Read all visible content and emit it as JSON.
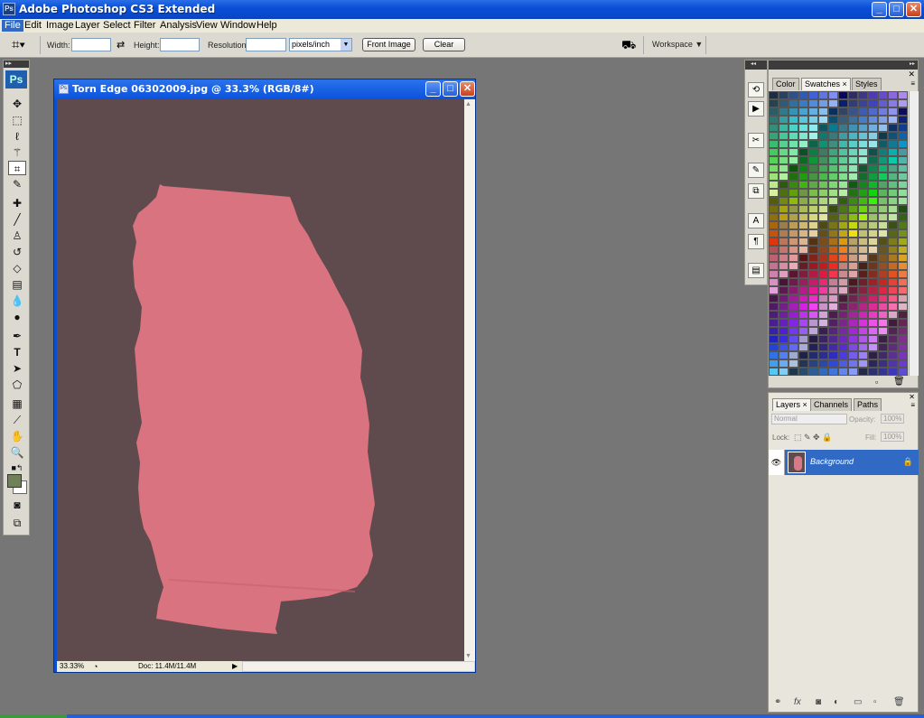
{
  "app": {
    "title": "Adobe Photoshop CS3 Extended",
    "logo_text": "Ps",
    "window_controls": {
      "minimize": "_",
      "maximize": "□",
      "close": "✕"
    }
  },
  "menu": [
    "File",
    "Edit",
    "Image",
    "Layer",
    "Select",
    "Filter",
    "Analysis",
    "View",
    "Window",
    "Help"
  ],
  "options_bar": {
    "width_label": "Width:",
    "width_value": "",
    "height_label": "Height:",
    "height_value": "",
    "resolution_label": "Resolution:",
    "resolution_value": "",
    "units_value": "pixels/inch",
    "front_image_label": "Front Image",
    "clear_label": "Clear",
    "workspace_label": "Workspace ▼"
  },
  "toolbox": {
    "badge": "Ps",
    "tools": [
      "move-icon",
      "marquee-icon",
      "lasso-icon",
      "magic-wand-icon",
      "crop-icon",
      "slice-icon",
      "healing-brush-icon",
      "brush-icon",
      "clone-stamp-icon",
      "history-brush-icon",
      "eraser-icon",
      "gradient-icon",
      "blur-icon",
      "dodge-icon",
      "pen-icon",
      "type-icon",
      "path-selection-icon",
      "shape-icon",
      "notes-icon",
      "eyedropper-icon",
      "hand-icon",
      "zoom-icon"
    ],
    "foreground_color": "#6e8158",
    "background_color": "#ffffff"
  },
  "document": {
    "title": "Torn Edge 06302009.jpg @ 33.3% (RGB/8#)",
    "zoom": "33.33%",
    "doc_size": "Doc: 11.4M/11.4M",
    "background_color": "#5f4a4e",
    "paper_color": "#d9737f"
  },
  "swatches_panel": {
    "tabs": [
      "Color",
      "Swatches ×",
      "Styles"
    ],
    "active_tab": "Swatches ×"
  },
  "layers_panel": {
    "tabs": [
      "Layers ×",
      "Channels",
      "Paths"
    ],
    "blend_mode": "Normal",
    "opacity_label": "Opacity:",
    "opacity_value": "100%",
    "lock_label": "Lock:",
    "fill_label": "Fill:",
    "fill_value": "100%",
    "layers": [
      {
        "name": "Background",
        "locked": true,
        "visible": true
      }
    ]
  },
  "colors": {
    "titlebar": "#0b4fd8",
    "selection": "#316ac5"
  }
}
